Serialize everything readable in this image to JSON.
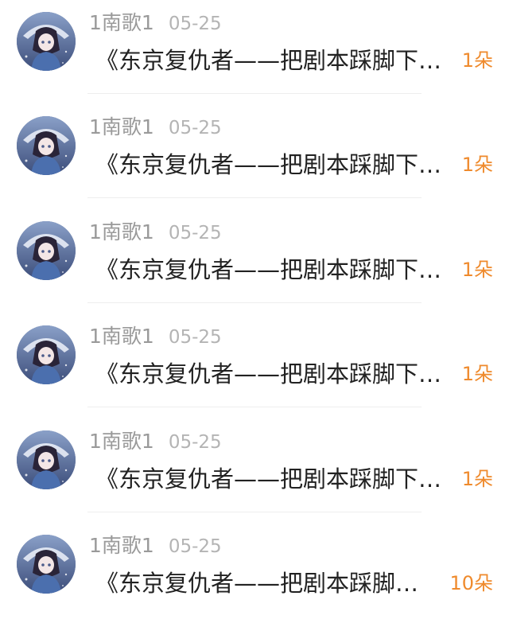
{
  "colors": {
    "name": "#9a9a9a",
    "date": "#b4b4b4",
    "title": "#222222",
    "count": "#ef8a2c",
    "divider": "#eeeeee"
  },
  "items": [
    {
      "name": "1南歌1",
      "date": "05-25",
      "title": "《东京复仇者——把剧本踩脚下……",
      "count": "1朵",
      "avatar_icon": "anime-girl-avatar"
    },
    {
      "name": "1南歌1",
      "date": "05-25",
      "title": "《东京复仇者——把剧本踩脚下……",
      "count": "1朵",
      "avatar_icon": "anime-girl-avatar"
    },
    {
      "name": "1南歌1",
      "date": "05-25",
      "title": "《东京复仇者——把剧本踩脚下……",
      "count": "1朵",
      "avatar_icon": "anime-girl-avatar"
    },
    {
      "name": "1南歌1",
      "date": "05-25",
      "title": "《东京复仇者——把剧本踩脚下……",
      "count": "1朵",
      "avatar_icon": "anime-girl-avatar"
    },
    {
      "name": "1南歌1",
      "date": "05-25",
      "title": "《东京复仇者——把剧本踩脚下……",
      "count": "1朵",
      "avatar_icon": "anime-girl-avatar"
    },
    {
      "name": "1南歌1",
      "date": "05-25",
      "title": "《东京复仇者——把剧本踩脚……",
      "count": "10朵",
      "avatar_icon": "anime-girl-avatar"
    }
  ]
}
